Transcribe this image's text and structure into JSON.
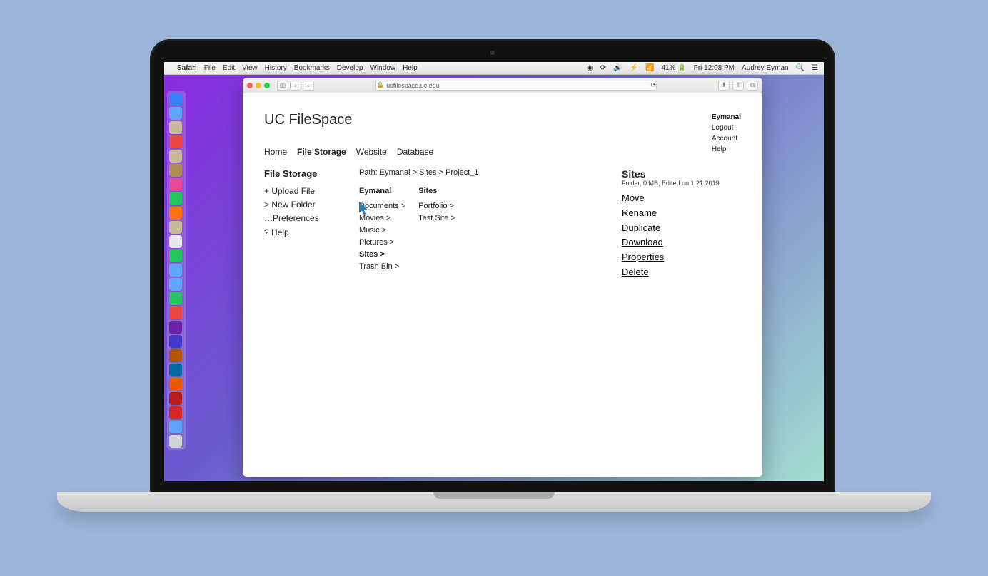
{
  "menubar": {
    "app": "Safari",
    "items": [
      "File",
      "Edit",
      "View",
      "History",
      "Bookmarks",
      "Develop",
      "Window",
      "Help"
    ],
    "battery": "41%",
    "time": "Fri 12:08 PM",
    "user": "Audrey Eyman"
  },
  "safari": {
    "url": "ucfilespace.uc.edu"
  },
  "page": {
    "title": "UC FileSpace",
    "user_menu": {
      "name": "Eymanal",
      "items": [
        "Logout",
        "Account",
        "Help"
      ]
    },
    "tabs": [
      "Home",
      "File Storage",
      "Website",
      "Database"
    ],
    "active_tab": "File Storage",
    "sidebar": {
      "heading": "File Storage",
      "upload": "+ Upload File",
      "newfolder": "> New Folder",
      "prefs": "…Preferences",
      "help": "? Help"
    },
    "path": "Path: Eymanal > Sites > Project_1",
    "columns": [
      {
        "title": "Eymanal",
        "items": [
          "Documents >",
          "Movies >",
          "Music >",
          "Pictures >",
          "Sites >",
          "Trash Bin >"
        ],
        "active": "Sites >"
      },
      {
        "title": "Sites",
        "items": [
          "Portfolio >",
          "Test Site >"
        ]
      }
    ],
    "details": {
      "title": "Sites",
      "meta": "Folder, 0 MB, Edited on 1.21.2019",
      "actions": [
        "Move",
        "Rename",
        "Duplicate",
        "Download",
        "Properties",
        "Delete"
      ]
    }
  },
  "dock_colors": [
    "#3b82f6",
    "#60a5fa",
    "#c7b99a",
    "#ef4444",
    "#c7b99a",
    "#b08d57",
    "#ec4899",
    "#22c55e",
    "#f97316",
    "#c7b99a",
    "#e5e7eb",
    "#22c55e",
    "#60a5fa",
    "#60a5fa",
    "#22c55e",
    "#ef4444",
    "#6b21a8",
    "#4338ca",
    "#b45309",
    "#0369a1",
    "#ea580c",
    "#b91c1c",
    "#dc2626",
    "#60a5fa",
    "#d1d5db"
  ]
}
